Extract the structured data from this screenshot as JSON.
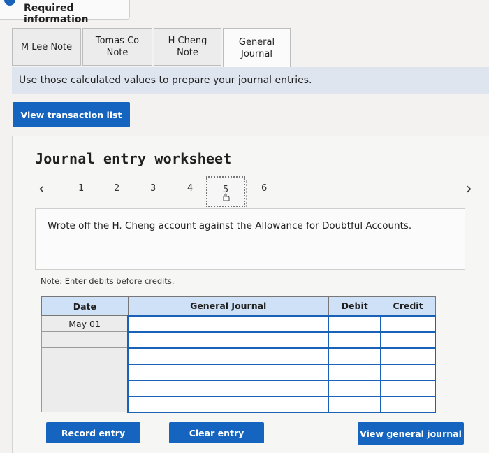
{
  "header": {
    "title": "Required information"
  },
  "tabs": [
    {
      "label": "M Lee Note"
    },
    {
      "label": "Tomas Co Note"
    },
    {
      "label": "H Cheng Note"
    },
    {
      "label": "General Journal"
    }
  ],
  "instruction": "Use those calculated values to prepare your journal entries.",
  "buttons": {
    "view_transactions": "View transaction list",
    "record_entry": "Record entry",
    "clear_entry": "Clear entry",
    "view_general_journal": "View general journal"
  },
  "worksheet": {
    "title": "Journal entry worksheet",
    "pages": [
      "1",
      "2",
      "3",
      "4",
      "5",
      "6"
    ],
    "active_page": "5",
    "description": "Wrote off the H. Cheng account against the Allowance for Doubtful Accounts.",
    "note": "Note: Enter debits before credits."
  },
  "journal": {
    "headers": {
      "date": "Date",
      "general_journal": "General Journal",
      "debit": "Debit",
      "credit": "Credit"
    },
    "rows": [
      {
        "date": "May 01"
      },
      {
        "date": ""
      },
      {
        "date": ""
      },
      {
        "date": ""
      },
      {
        "date": ""
      },
      {
        "date": ""
      }
    ]
  },
  "colors": {
    "accent": "#1565c0",
    "header_bg": "#cfe1f6",
    "instruction_bg": "#dfe5ee"
  }
}
